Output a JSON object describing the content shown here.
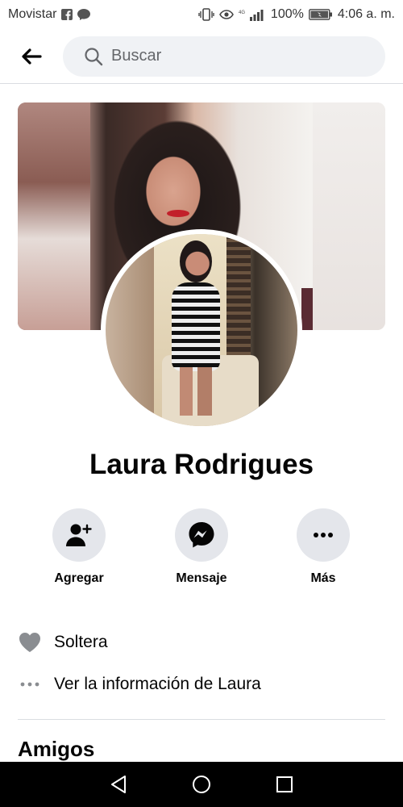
{
  "status_bar": {
    "carrier": "Movistar",
    "network": "4G",
    "battery": "100%",
    "time": "4:06 a. m.",
    "icons": [
      "facebook-icon",
      "messenger-bubble-icon",
      "vibrate-icon",
      "eye-icon",
      "signal-icon",
      "battery-icon"
    ]
  },
  "header": {
    "search_placeholder": "Buscar"
  },
  "profile": {
    "name": "Laura Rodrigues"
  },
  "actions": [
    {
      "label": "Agregar",
      "icon": "add-friend-icon"
    },
    {
      "label": "Mensaje",
      "icon": "messenger-icon"
    },
    {
      "label": "Más",
      "icon": "more-icon"
    }
  ],
  "info": {
    "relationship": "Soltera",
    "see_info": "Ver la información de Laura"
  },
  "sections": {
    "friends_title": "Amigos"
  },
  "colors": {
    "accent": "#050505",
    "button_bg": "#e4e6eb",
    "search_bg": "#f0f2f5",
    "muted": "#65676b"
  }
}
